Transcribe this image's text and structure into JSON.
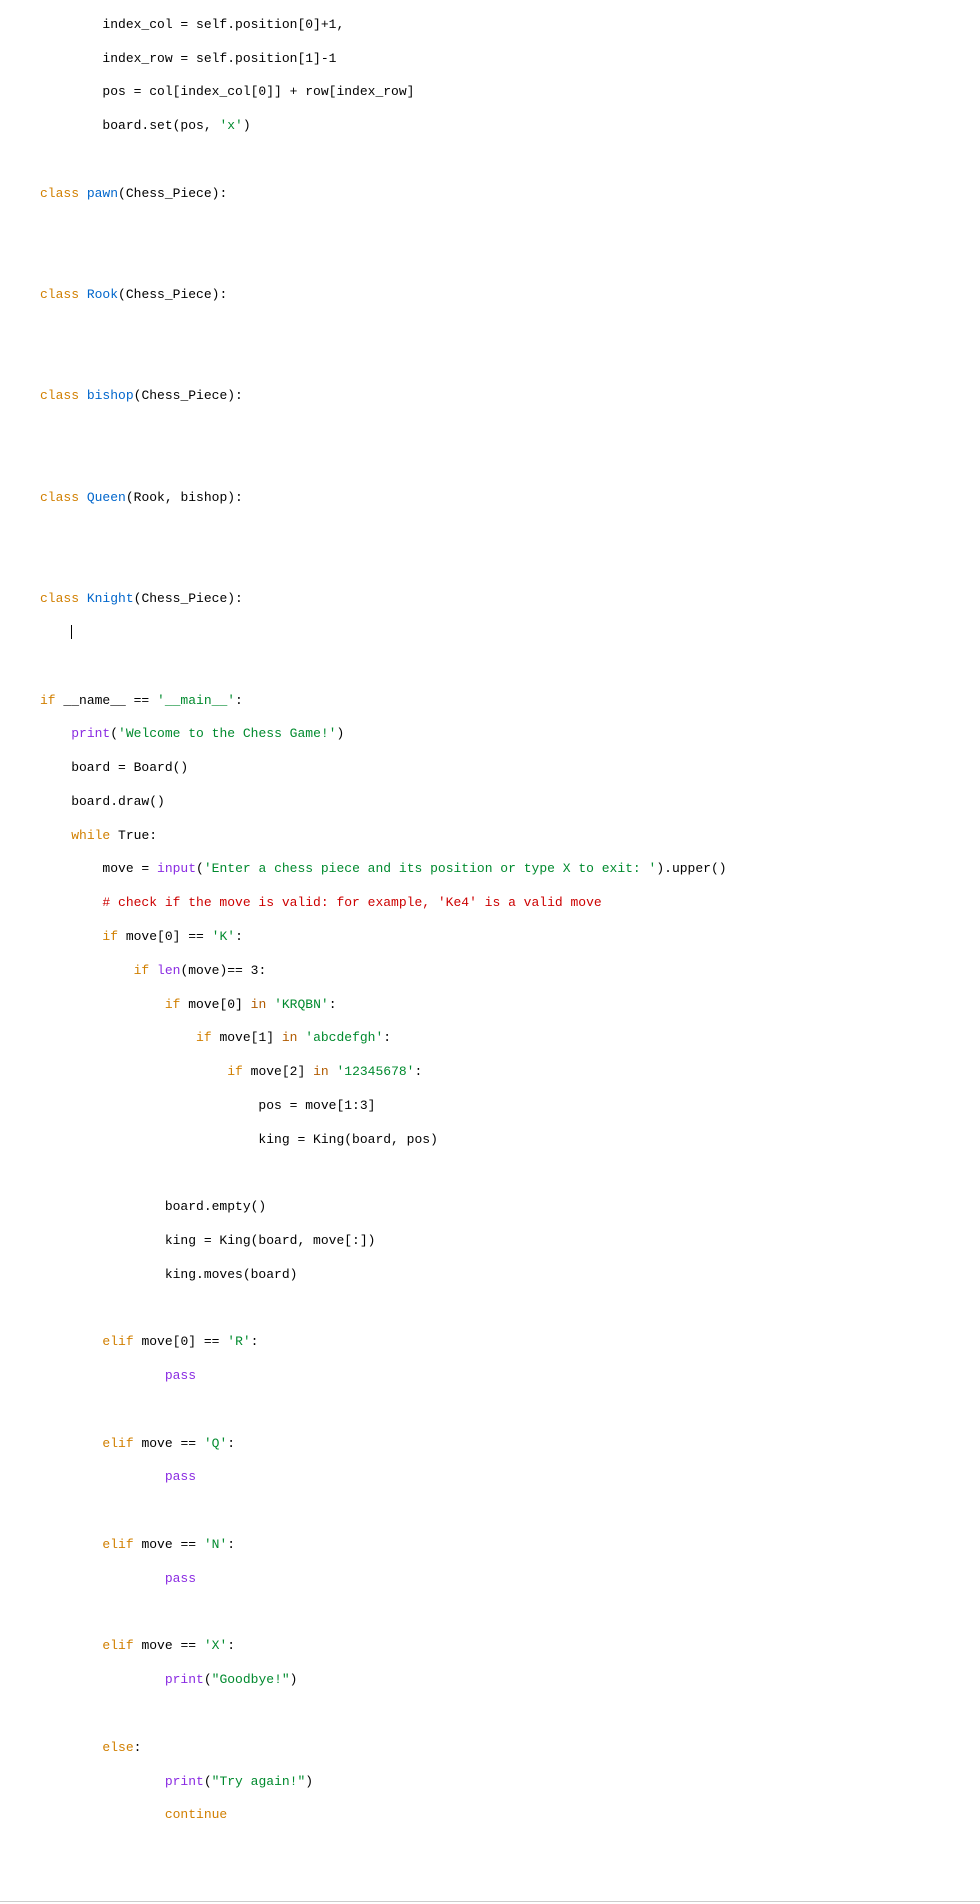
{
  "code": {
    "l01": "        index_col = self.position[0]+1,",
    "l02": "        index_row = self.position[1]-1",
    "l03": "        pos = col[index_col[0]] + row[index_row]",
    "l04a": "        board.set(pos, ",
    "l04b": "'x'",
    "l04c": ")",
    "cls_kw": "class",
    "pawn": "pawn",
    "rook": "Rook",
    "bishop": "bishop",
    "queen": "Queen",
    "knight": "Knight",
    "chess_piece": "(Chess_Piece):",
    "rook_bishop": "(Rook, bishop):",
    "if_kw": "if",
    "name_test_a": " __name__ == ",
    "name_test_b": "'__main__'",
    "name_test_c": ":",
    "print_fn": "print",
    "welcome": "'Welcome to the Chess Game!'",
    "board_init": "    board = Board()",
    "board_draw": "    board.draw()",
    "while_kw": "while",
    "true_tail": " True:",
    "move_eq": "        move = ",
    "input_fn": "input",
    "input_str": "'Enter a chess piece and its position or type X to exit: '",
    "upper_call": ").upper()",
    "comment_valid": "        # check if the move is valid: for example, 'Ke4' is a valid move",
    "if_move0": " move[0] == ",
    "K": "'K'",
    "colon": ":",
    "len_fn": "len",
    "len_tail": "(move)== 3:",
    "if_move0b": " move[0] ",
    "in_kw": "in",
    "KRQBN": " 'KRQBN'",
    "if_move1": " move[1] ",
    "abcdefgh": " 'abcdefgh'",
    "if_move2": " move[2] ",
    "digits": " '12345678'",
    "pos_assign": "                            pos = move[1:3]",
    "king_assign": "                            king = King(board, pos)",
    "board_empty": "                board.empty()",
    "king2": "                king = King(board, move[:])",
    "king_moves": "                king.moves(board)",
    "elif_kw": "elif",
    "R": "'R'",
    "pass_kw": "pass",
    "move_eq_only": " move == ",
    "Q": "'Q'",
    "N": "'N'",
    "X": "'X'",
    "goodbye": "\"Goodbye!\"",
    "else_kw": "else",
    "tryagain": "\"Try again!\"",
    "continue_kw": "continue",
    "paren_open": "(",
    "paren_close": ")"
  }
}
